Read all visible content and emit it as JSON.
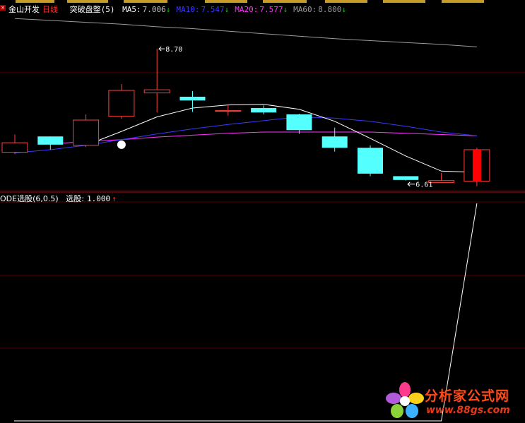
{
  "header": {
    "stock_name": "金山开发",
    "period": "日线",
    "indicator": "突破盘整",
    "indicator_param": "(5)",
    "ma": [
      {
        "label": "MA5:",
        "value": "7.006",
        "arrow": "↓",
        "color": "#ffffff",
        "value_color": "#c0c0c0"
      },
      {
        "label": "MA10:",
        "value": "7.547",
        "arrow": "↓",
        "color": "#3a3aff",
        "value_color": "#3a3aff"
      },
      {
        "label": "MA20:",
        "value": "7.577",
        "arrow": "↓",
        "color": "#ff33ff",
        "value_color": "#ff33ff"
      },
      {
        "label": "MA60:",
        "value": "8.800",
        "arrow": "↓",
        "color": "#9a9a9a",
        "value_color": "#9a9a9a"
      }
    ],
    "arrow_color": "#00d000"
  },
  "sub_header": {
    "formula": "ODE选股(6,0.5)",
    "item_label": "选股:",
    "item_value": "1.000",
    "arrow": "↑",
    "arrow_color": "#ff3030"
  },
  "annotations": {
    "high_label": "8.70",
    "low_label": "6.61"
  },
  "watermark": {
    "cn": "分析家公式网",
    "url": "www.88gs.com"
  },
  "colors": {
    "up": "#ff4040",
    "down": "#54ffff",
    "grid": "#5a0000",
    "ma5": "#ffffff",
    "ma10": "#3a3aff",
    "ma20": "#ff33ff",
    "ma60": "#9a9a9a",
    "signal": "#ffffff"
  },
  "chart_data": [
    {
      "type": "candlestick",
      "title": "突破盘整(5)",
      "ylim": [
        6.45,
        9.25
      ],
      "candles": [
        {
          "open": 7.06,
          "close": 7.21,
          "high": 7.34,
          "low": 7.03
        },
        {
          "open": 7.31,
          "close": 7.18,
          "high": 7.31,
          "low": 7.1
        },
        {
          "open": 7.17,
          "close": 7.57,
          "high": 7.66,
          "low": 7.14
        },
        {
          "open": 7.63,
          "close": 8.04,
          "high": 8.14,
          "low": 7.59
        },
        {
          "open": 8.0,
          "close": 8.05,
          "high": 8.7,
          "low": 7.69
        },
        {
          "open": 7.94,
          "close": 7.88,
          "high": 8.03,
          "low": 7.7
        },
        {
          "open": 7.72,
          "close": 7.72,
          "high": 7.81,
          "low": 7.64
        },
        {
          "open": 7.76,
          "close": 7.69,
          "high": 7.8,
          "low": 7.66
        },
        {
          "open": 7.66,
          "close": 7.41,
          "high": 7.67,
          "low": 7.35
        },
        {
          "open": 7.31,
          "close": 7.13,
          "high": 7.45,
          "low": 7.07
        },
        {
          "open": 7.13,
          "close": 6.72,
          "high": 7.17,
          "low": 6.68
        },
        {
          "open": 6.68,
          "close": 6.62,
          "high": 6.68,
          "low": 6.61
        },
        {
          "open": 6.58,
          "close": 6.61,
          "high": 6.73,
          "low": 6.58
        },
        {
          "open": 6.6,
          "close": 7.1,
          "high": 7.13,
          "low": 6.52
        }
      ],
      "ma5": [
        null,
        null,
        7.17,
        7.39,
        7.62,
        7.76,
        7.81,
        7.82,
        7.74,
        7.55,
        7.28,
        7.0,
        6.76,
        6.74
      ],
      "ma10": [
        7.05,
        7.1,
        7.17,
        7.26,
        7.35,
        7.43,
        7.5,
        7.56,
        7.62,
        7.6,
        7.55,
        7.47,
        7.38,
        7.32
      ],
      "ma20": [
        null,
        7.19,
        7.23,
        7.26,
        7.3,
        7.33,
        7.36,
        7.38,
        7.38,
        7.38,
        7.38,
        7.36,
        7.34,
        7.32
      ],
      "ma60": [
        9.18,
        9.15,
        9.12,
        9.09,
        9.05,
        9.02,
        8.98,
        8.94,
        8.9,
        8.86,
        8.83,
        8.8,
        8.77,
        8.73
      ]
    },
    {
      "type": "line",
      "title": "ODE选股(6,0.5)",
      "series": [
        {
          "name": "选股",
          "values": [
            0,
            0,
            0,
            0,
            0,
            0,
            0,
            0,
            0,
            0,
            0,
            0,
            0,
            1
          ]
        }
      ],
      "ylim": [
        0,
        1
      ]
    }
  ]
}
